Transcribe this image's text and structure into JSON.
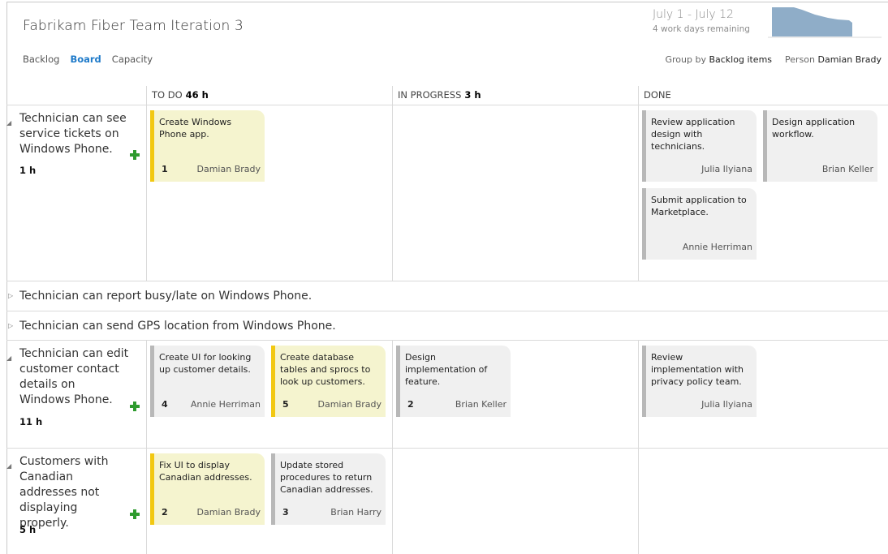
{
  "header": {
    "title": "Fabrikam Fiber Team Iteration 3",
    "nav": [
      "Backlog",
      "Board",
      "Capacity"
    ],
    "sprint_dates": "July 1 - July 12",
    "sprint_remaining": "4 work days remaining",
    "groupby_label": "Group by",
    "groupby_value": "Backlog items",
    "person_label": "Person",
    "person_value": "Damian Brady"
  },
  "columns": [
    {
      "label": "TO DO",
      "hours": "46 h"
    },
    {
      "label": "IN PROGRESS",
      "hours": "3 h"
    },
    {
      "label": "DONE",
      "hours": ""
    }
  ],
  "stories": [
    {
      "title": "Technician can see service tickets on Windows Phone.",
      "hours": "1 h",
      "cards": [
        {
          "text": "Create Windows Phone app.",
          "num": "1",
          "owner": "Damian Brady",
          "color": "yellow"
        },
        {
          "text": "Review application design with technicians.",
          "num": "",
          "owner": "Julia Ilyiana",
          "color": "gray"
        },
        {
          "text": "Design application workflow.",
          "num": "",
          "owner": "Brian Keller",
          "color": "gray"
        },
        {
          "text": "Submit application to Marketplace.",
          "num": "",
          "owner": "Annie Herriman",
          "color": "gray"
        }
      ]
    },
    {
      "title": "Technician can edit customer contact details on Windows Phone.",
      "hours": "11 h",
      "cards": [
        {
          "text": "Create UI for looking up customer details.",
          "num": "4",
          "owner": "Annie Herriman",
          "color": "gray"
        },
        {
          "text": "Create database tables and sprocs to look up customers.",
          "num": "5",
          "owner": "Damian Brady",
          "color": "yellow"
        },
        {
          "text": "Design implementation of feature.",
          "num": "2",
          "owner": "Brian Keller",
          "color": "gray"
        },
        {
          "text": "Review implementation with privacy policy team.",
          "num": "",
          "owner": "Julia Ilyiana",
          "color": "gray"
        }
      ]
    },
    {
      "title": "Customers with Canadian addresses not displaying properly.",
      "hours": "5 h",
      "cards": [
        {
          "text": "Fix UI to display Canadian addresses.",
          "num": "2",
          "owner": "Damian Brady",
          "color": "yellow"
        },
        {
          "text": "Update stored procedures to return Canadian addresses.",
          "num": "3",
          "owner": "Brian Harry",
          "color": "gray"
        }
      ]
    }
  ],
  "collapsed_stories": [
    "Technician can report busy/late on Windows Phone.",
    "Technician can send GPS location from Windows Phone."
  ],
  "colors": {
    "accent": "#1e7ac9",
    "card_yellow": "#f5f4cf",
    "card_yellow_bar": "#f2c811",
    "card_gray": "#f0f0f0",
    "card_gray_bar": "#b8b8b8",
    "add_icon": "#2e9b2e",
    "burndown": "#8fadc8"
  }
}
